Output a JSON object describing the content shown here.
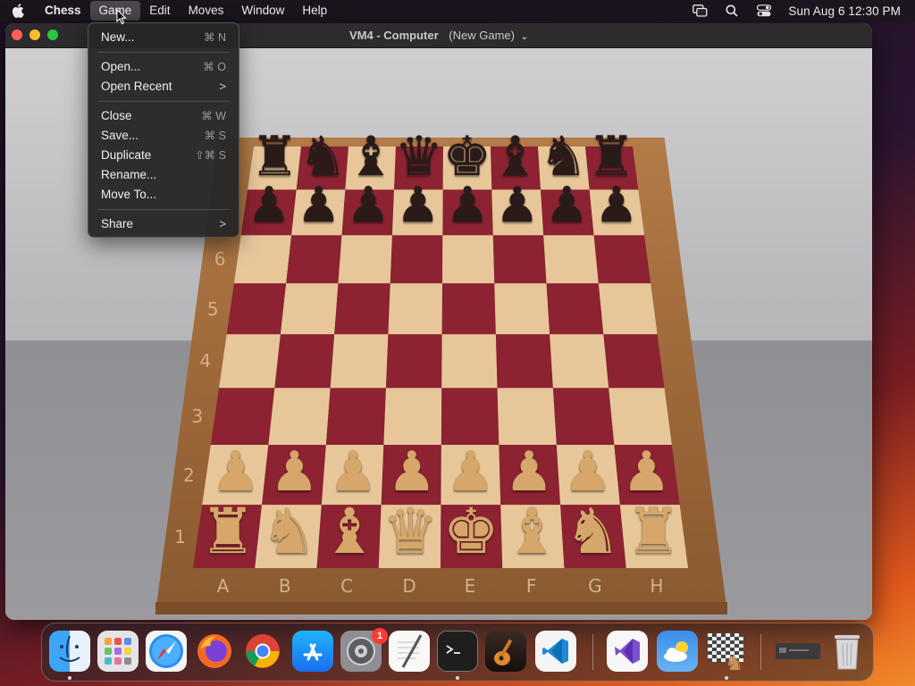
{
  "menubar": {
    "app_name": "Chess",
    "items": [
      "Game",
      "Edit",
      "Moves",
      "Window",
      "Help"
    ],
    "active_item": "Game",
    "clock": "Sun Aug 6  12:30 PM",
    "status_icons": [
      "screen-mirroring-icon",
      "search-icon",
      "control-center-icon"
    ]
  },
  "window": {
    "title": "VM4 - Computer",
    "subtitle": "(New Game)",
    "title_chevron": "⌄"
  },
  "game_menu": {
    "items": [
      {
        "label": "New...",
        "shortcut": "⌘ N"
      },
      {
        "label": "Open...",
        "shortcut": "⌘ O"
      },
      {
        "label": "Open Recent",
        "submenu": true
      },
      {
        "label": "Close",
        "shortcut": "⌘ W"
      },
      {
        "label": "Save...",
        "shortcut": "⌘ S"
      },
      {
        "label": "Duplicate",
        "shortcut": "⇧⌘ S"
      },
      {
        "label": "Rename..."
      },
      {
        "label": "Move To..."
      },
      {
        "label": "Share",
        "submenu": true
      }
    ],
    "submenu_arrow": ">"
  },
  "board": {
    "ranks": [
      "1",
      "2",
      "3",
      "4",
      "5",
      "6"
    ],
    "files": [
      "A",
      "B",
      "C",
      "D",
      "E",
      "F",
      "G",
      "H"
    ],
    "light_square": "#e7c79a",
    "dark_square": "#8c2232",
    "black_back_rank": [
      "♜",
      "♞",
      "♝",
      "♛",
      "♚",
      "♝",
      "♞",
      "♜"
    ],
    "black_pawns": [
      "♟",
      "♟",
      "♟",
      "♟",
      "♟",
      "♟",
      "♟",
      "♟"
    ],
    "white_back_rank": [
      "♜",
      "♞",
      "♝",
      "♛",
      "♚",
      "♝",
      "♞",
      "♜"
    ],
    "white_pawns": [
      "♟",
      "♟",
      "♟",
      "♟",
      "♟",
      "♟",
      "♟",
      "♟"
    ]
  },
  "dock": {
    "apps": [
      "Finder",
      "Launchpad",
      "Safari",
      "Firefox",
      "Google Chrome",
      "App Store",
      "System Settings",
      "TextEdit",
      "Terminal",
      "GarageBand",
      "Visual Studio Code",
      "Visual Studio",
      "Weather",
      "Chess",
      "Downloads",
      "Trash"
    ],
    "settings_badge": "1"
  },
  "colors": {
    "menu_bg": "#262628",
    "accent_red": "#ff5f57",
    "accent_yellow": "#febc2e",
    "accent_green": "#28c840"
  }
}
